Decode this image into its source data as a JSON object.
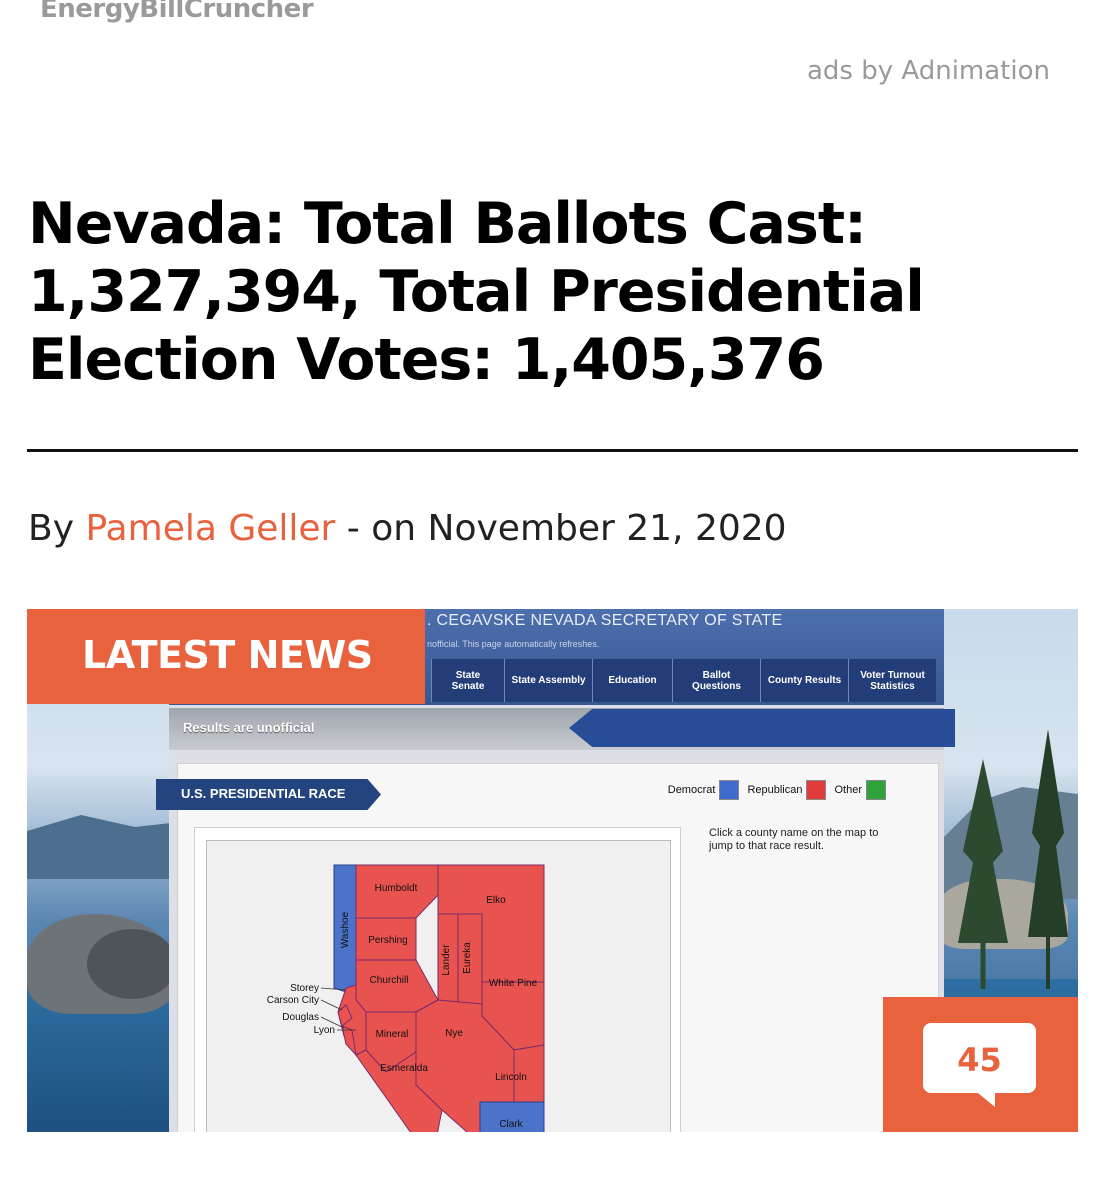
{
  "site": {
    "brand": "EnergyBillCruncher",
    "ads": "ads by Adnimation"
  },
  "article": {
    "title": "Nevada: Total Ballots Cast: 1,327,394, Total Presidential Election Votes: 1,405,376",
    "by_label": "By",
    "author": "Pamela Geller",
    "date_prefix": "- on",
    "date": "November 21, 2020"
  },
  "hero": {
    "latest_news": "LATEST NEWS",
    "comment_count": "45",
    "sos_title": ". CEGAVSKE   NEVADA SECRETARY OF STATE",
    "sos_note": "nofficial. This page automatically refreshes.",
    "nav": [
      "State Senate",
      "State Assembly",
      "Education",
      "Ballot Questions",
      "County Results",
      "Voter Turnout Statistics"
    ],
    "results_bar": "Results are unofficial",
    "race_title": "U.S. PRESIDENTIAL RACE",
    "legend": [
      {
        "label": "Democrat",
        "color": "#3f6ccc"
      },
      {
        "label": "Republican",
        "color": "#e23b3b"
      },
      {
        "label": "Other",
        "color": "#2ea33a"
      }
    ],
    "help_text": "Click a county name on the map to jump to that race result.",
    "counties": [
      {
        "name": "Humboldt",
        "party": "Republican"
      },
      {
        "name": "Elko",
        "party": "Republican"
      },
      {
        "name": "Washoe",
        "party": "Democrat"
      },
      {
        "name": "Pershing",
        "party": "Republican"
      },
      {
        "name": "Lander",
        "party": "Republican"
      },
      {
        "name": "Eureka",
        "party": "Republican"
      },
      {
        "name": "Churchill",
        "party": "Republican"
      },
      {
        "name": "White Pine",
        "party": "Republican"
      },
      {
        "name": "Storey",
        "party": "Republican"
      },
      {
        "name": "Carson City",
        "party": "Republican"
      },
      {
        "name": "Douglas",
        "party": "Republican"
      },
      {
        "name": "Lyon",
        "party": "Republican"
      },
      {
        "name": "Mineral",
        "party": "Republican"
      },
      {
        "name": "Nye",
        "party": "Republican"
      },
      {
        "name": "Esmeralda",
        "party": "Republican"
      },
      {
        "name": "Lincoln",
        "party": "Republican"
      },
      {
        "name": "Clark",
        "party": "Democrat"
      }
    ],
    "colors": {
      "accent": "#e8623d",
      "republican": "#e8534f",
      "democrat": "#4a73c9"
    }
  }
}
